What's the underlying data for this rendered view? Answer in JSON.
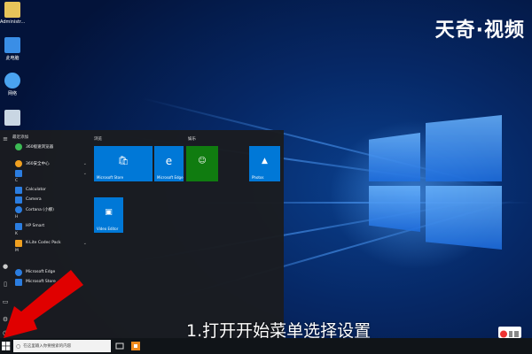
{
  "watermark": "天奇·视频",
  "subtitle": "1.打开开始菜单选择设置",
  "desktop_icons": [
    {
      "label": "Administr..."
    },
    {
      "label": "此电脑"
    },
    {
      "label": "网络"
    },
    {
      "label": ""
    }
  ],
  "start_menu": {
    "list_header": "最近添加",
    "items": {
      "i0": "360极速浏览器",
      "i1": "360安全中心",
      "i2": "",
      "i3": "Calculator",
      "i4": "Camera",
      "i5": "Cortana (小娜)",
      "i6": "HP Smart",
      "i7": "K-Lite Codec Pack",
      "i8": "Microsoft Edge",
      "i9": "Microsoft Store"
    },
    "letters": {
      "c": "C",
      "h": "H",
      "k": "K",
      "m": "M"
    },
    "groups": {
      "g1": "浏览",
      "g2": "娱乐"
    },
    "tiles": {
      "store": "Microsoft Store",
      "edge": "Microsoft Edge",
      "photos": "Photos",
      "video": "Video Editor"
    }
  },
  "taskbar": {
    "search_placeholder": "在这里输入你要搜索的内容"
  },
  "colors": {
    "tile_blue": "#0078d7",
    "arrow_red": "#e00000",
    "xbox_green": "#107c10"
  },
  "icons": [
    "settings-gear-icon",
    "power-icon",
    "document-icon",
    "picture-icon",
    "user-icon",
    "search-icon",
    "windows-logo-icon"
  ]
}
